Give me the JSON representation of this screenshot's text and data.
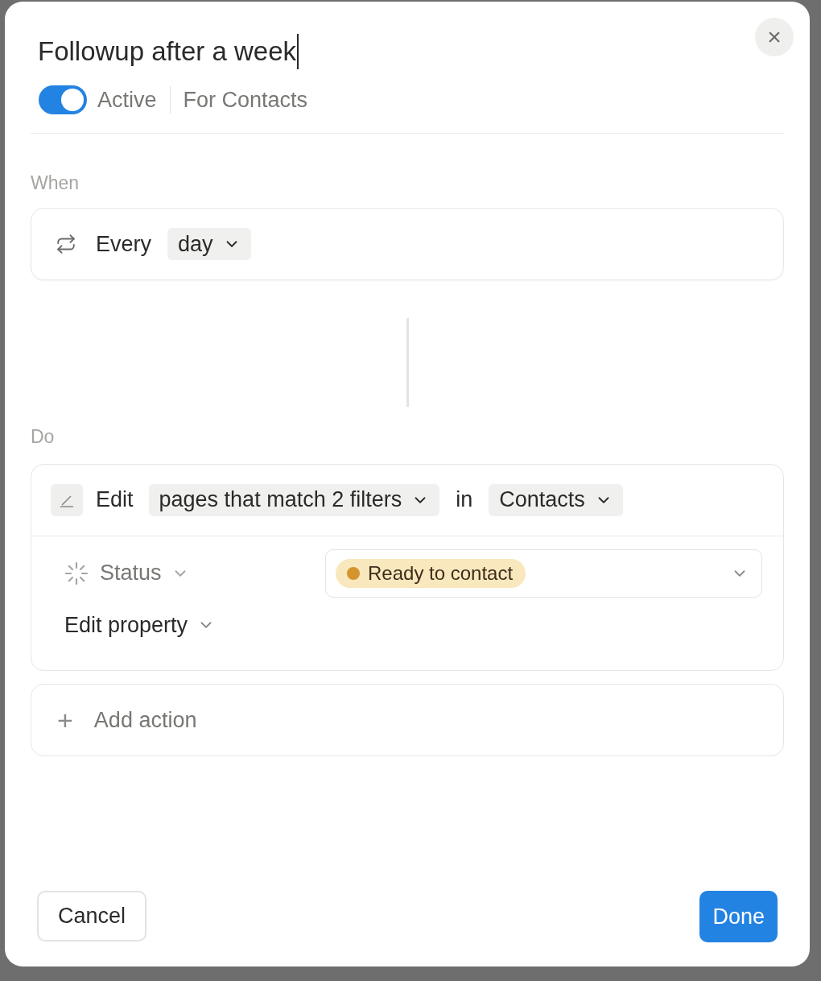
{
  "dialog": {
    "title": "Followup after a week",
    "close_label": "×",
    "active": {
      "on": true,
      "label": "Active"
    },
    "scope": "For Contacts",
    "trigger": {
      "heading": "When",
      "label": "Every",
      "value": "day"
    },
    "action": {
      "heading": "Do",
      "verb": "Edit",
      "target": "pages that match 2 filters",
      "preposition": "in",
      "database": "Contacts",
      "property": {
        "name": "Status",
        "value": "Ready to contact",
        "color": "#d4952e"
      },
      "edit_property": "Edit property"
    },
    "add_action": {
      "icon": "+",
      "label": "Add action"
    },
    "cancel": "Cancel",
    "done": "Done"
  }
}
